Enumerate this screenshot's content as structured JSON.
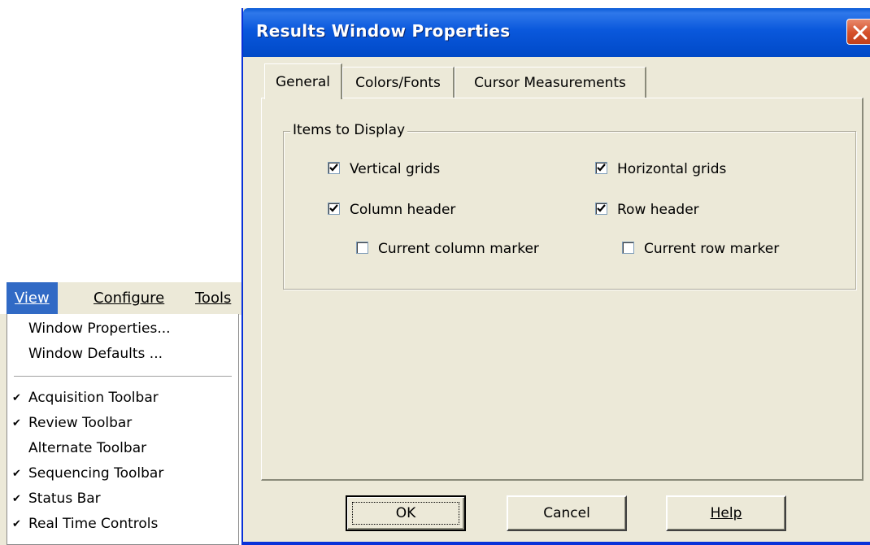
{
  "menubar": {
    "items": [
      {
        "label": "View",
        "active": true
      },
      {
        "label": "Configure",
        "active": false
      },
      {
        "label": "Tools",
        "active": false
      }
    ]
  },
  "view_menu": {
    "items": [
      {
        "label": "Window Properties...",
        "checked": false
      },
      {
        "label": "Window Defaults ...",
        "checked": false
      },
      {
        "separator": true
      },
      {
        "label": "Acquisition Toolbar",
        "checked": true
      },
      {
        "label": "Review Toolbar",
        "checked": true
      },
      {
        "label": "Alternate Toolbar",
        "checked": false
      },
      {
        "label": "Sequencing Toolbar",
        "checked": true
      },
      {
        "label": "Status Bar",
        "checked": true
      },
      {
        "label": "Real Time Controls",
        "checked": true
      }
    ],
    "check_glyph": "✔"
  },
  "dialog": {
    "title": "Results Window Properties",
    "close_icon": "close-x-icon",
    "tabs": [
      {
        "label": "General",
        "selected": true
      },
      {
        "label": "Colors/Fonts",
        "selected": false
      },
      {
        "label": "Cursor Measurements",
        "selected": false
      }
    ],
    "group": {
      "legend": "Items to Display",
      "checkboxes": [
        {
          "label": "Vertical grids",
          "checked": true
        },
        {
          "label": "Horizontal grids",
          "checked": true
        },
        {
          "label": "Column header",
          "checked": true
        },
        {
          "label": "Row header",
          "checked": true
        },
        {
          "label": "Current column marker",
          "checked": false
        },
        {
          "label": "Current row marker",
          "checked": false
        }
      ]
    },
    "buttons": {
      "ok": "OK",
      "cancel": "Cancel",
      "help": "Help"
    }
  },
  "colors": {
    "titlebar": "#0a58dc",
    "menu_highlight": "#316ac5",
    "close_button": "#d4502a",
    "dialog_face": "#ece9d8"
  }
}
